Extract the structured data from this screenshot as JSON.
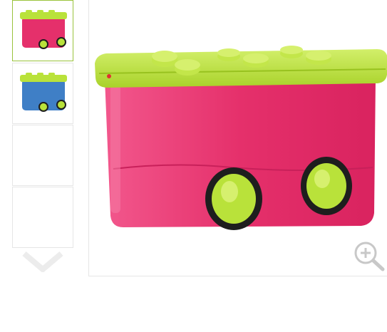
{
  "gallery": {
    "thumbnails": [
      {
        "id": "pink-box",
        "selected": true,
        "body_color": "#e5306b",
        "lid_color": "#b9e23a"
      },
      {
        "id": "blue-box",
        "selected": false,
        "body_color": "#3f7fc6",
        "lid_color": "#b9e23a"
      },
      {
        "id": "empty-1",
        "selected": false
      },
      {
        "id": "empty-2",
        "selected": false
      }
    ],
    "next_icon": "chevron-down-icon",
    "zoom_icon": "zoom-in-icon"
  },
  "product": {
    "body_color": "#e5306b",
    "lid_color": "#b9e23a",
    "wheel_color": "#b9e23a",
    "tire_color": "#1e1e1e"
  }
}
